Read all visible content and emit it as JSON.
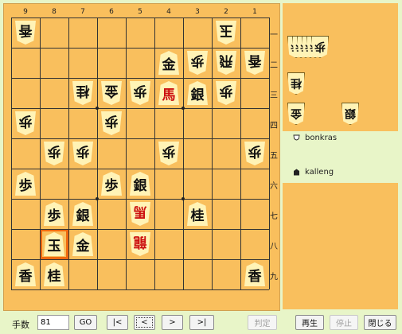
{
  "board": {
    "column_labels": [
      "9",
      "8",
      "7",
      "6",
      "5",
      "4",
      "3",
      "2",
      "1"
    ],
    "row_labels": [
      "一",
      "二",
      "三",
      "四",
      "五",
      "六",
      "七",
      "八",
      "九"
    ],
    "highlight_square": {
      "file": 8,
      "rank": 8
    },
    "pieces": [
      {
        "file": 9,
        "rank": 1,
        "char": "香",
        "side": "gote",
        "name": "lance"
      },
      {
        "file": 2,
        "rank": 1,
        "char": "玉",
        "side": "gote",
        "name": "king"
      },
      {
        "file": 4,
        "rank": 2,
        "char": "金",
        "side": "sente",
        "name": "gold"
      },
      {
        "file": 3,
        "rank": 2,
        "char": "歩",
        "side": "gote",
        "name": "pawn"
      },
      {
        "file": 2,
        "rank": 2,
        "char": "飛",
        "side": "gote",
        "name": "rook"
      },
      {
        "file": 1,
        "rank": 2,
        "char": "香",
        "side": "gote",
        "name": "lance"
      },
      {
        "file": 7,
        "rank": 3,
        "char": "桂",
        "side": "gote",
        "name": "knight"
      },
      {
        "file": 6,
        "rank": 3,
        "char": "金",
        "side": "gote",
        "name": "gold"
      },
      {
        "file": 5,
        "rank": 3,
        "char": "歩",
        "side": "gote",
        "name": "pawn"
      },
      {
        "file": 4,
        "rank": 3,
        "char": "馬",
        "side": "sente",
        "prom": true,
        "name": "horse"
      },
      {
        "file": 3,
        "rank": 3,
        "char": "銀",
        "side": "sente",
        "name": "silver"
      },
      {
        "file": 2,
        "rank": 3,
        "char": "歩",
        "side": "gote",
        "name": "pawn"
      },
      {
        "file": 9,
        "rank": 4,
        "char": "歩",
        "side": "gote",
        "name": "pawn"
      },
      {
        "file": 6,
        "rank": 4,
        "char": "歩",
        "side": "gote",
        "name": "pawn"
      },
      {
        "file": 8,
        "rank": 5,
        "char": "歩",
        "side": "gote",
        "name": "pawn"
      },
      {
        "file": 7,
        "rank": 5,
        "char": "歩",
        "side": "gote",
        "name": "pawn"
      },
      {
        "file": 4,
        "rank": 5,
        "char": "歩",
        "side": "gote",
        "name": "pawn"
      },
      {
        "file": 1,
        "rank": 5,
        "char": "歩",
        "side": "gote",
        "name": "pawn"
      },
      {
        "file": 9,
        "rank": 6,
        "char": "歩",
        "side": "sente",
        "name": "pawn"
      },
      {
        "file": 6,
        "rank": 6,
        "char": "歩",
        "side": "sente",
        "name": "pawn"
      },
      {
        "file": 5,
        "rank": 6,
        "char": "銀",
        "side": "sente",
        "name": "silver"
      },
      {
        "file": 8,
        "rank": 7,
        "char": "歩",
        "side": "sente",
        "name": "pawn"
      },
      {
        "file": 7,
        "rank": 7,
        "char": "銀",
        "side": "sente",
        "name": "silver"
      },
      {
        "file": 5,
        "rank": 7,
        "char": "馬",
        "side": "gote",
        "prom": true,
        "name": "horse"
      },
      {
        "file": 3,
        "rank": 7,
        "char": "桂",
        "side": "sente",
        "name": "knight"
      },
      {
        "file": 8,
        "rank": 8,
        "char": "玉",
        "side": "sente",
        "name": "king"
      },
      {
        "file": 7,
        "rank": 8,
        "char": "金",
        "side": "sente",
        "name": "gold"
      },
      {
        "file": 5,
        "rank": 8,
        "char": "龍",
        "side": "gote",
        "prom": true,
        "name": "dragon"
      },
      {
        "file": 9,
        "rank": 9,
        "char": "香",
        "side": "sente",
        "name": "lance"
      },
      {
        "file": 8,
        "rank": 9,
        "char": "桂",
        "side": "sente",
        "name": "knight"
      },
      {
        "file": 1,
        "rank": 9,
        "char": "香",
        "side": "sente",
        "name": "lance"
      }
    ]
  },
  "hands": {
    "gote": [
      {
        "char": "歩",
        "count": 6
      },
      {
        "char": "桂",
        "count": 1
      },
      {
        "char": "金",
        "count": 1
      },
      {
        "char": "銀",
        "count": 1
      }
    ],
    "sente": []
  },
  "players": {
    "gote": {
      "name": "bonkras",
      "icon": "white-king-icon"
    },
    "sente": {
      "name": "kalleng",
      "icon": "black-king-icon"
    }
  },
  "controls": {
    "move_label": "手数",
    "move_value": "81",
    "go": "GO",
    "first": "|<",
    "prev": "<",
    "next": ">",
    "last": ">|",
    "judge": "判定",
    "play": "再生",
    "stop": "停止",
    "close": "閉じる"
  }
}
